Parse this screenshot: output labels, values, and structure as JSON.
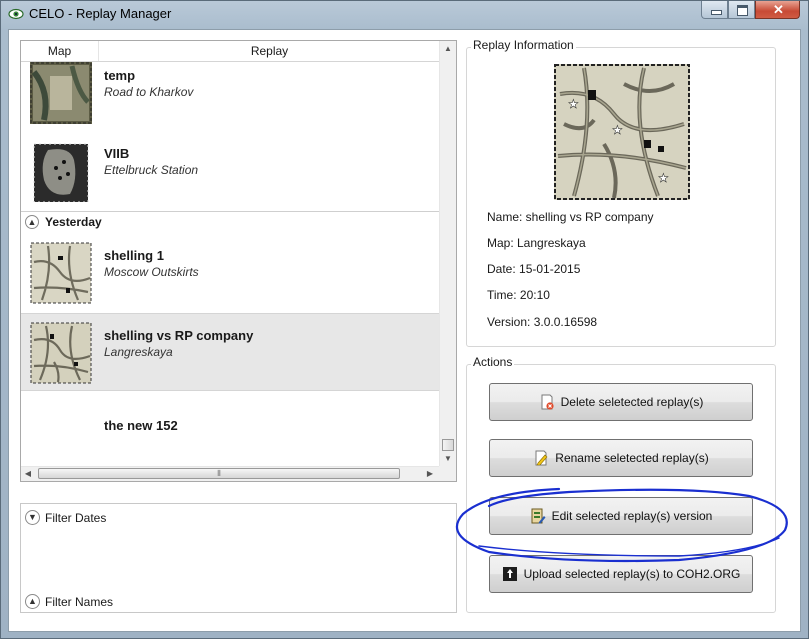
{
  "window": {
    "title": "CELO - Replay Manager",
    "controls": [
      "minimize",
      "maximize",
      "close"
    ]
  },
  "list": {
    "columns": {
      "map": "Map",
      "replay": "Replay"
    },
    "rows": [
      {
        "name": "temp",
        "map": "Road to Kharkov"
      },
      {
        "name": "VIIB",
        "map": "Ettelbruck Station"
      }
    ],
    "group": {
      "label": "Yesterday"
    },
    "group_rows": [
      {
        "name": "shelling 1",
        "map": "Moscow Outskirts",
        "selected": false
      },
      {
        "name": "shelling vs RP company",
        "map": "Langreskaya",
        "selected": true
      },
      {
        "name": "the new 152",
        "map": "",
        "selected": false
      }
    ]
  },
  "filters": {
    "dates": "Filter Dates",
    "names": "Filter Names"
  },
  "info": {
    "title": "Replay Information",
    "name": "Name: shelling vs RP company",
    "map": "Map: Langreskaya",
    "date": "Date: 15-01-2015",
    "time": "Time: 20:10",
    "version": "Version: 3.0.0.16598"
  },
  "actions": {
    "title": "Actions",
    "delete": "Delete seletected replay(s)",
    "rename": "Rename seletected replay(s)",
    "edit": "Edit selected replay(s) version",
    "upload": "Upload selected replay(s) to COH2.ORG"
  },
  "colors": {
    "selection": "#e7e7e7",
    "annotation": "#1a2fd0"
  }
}
